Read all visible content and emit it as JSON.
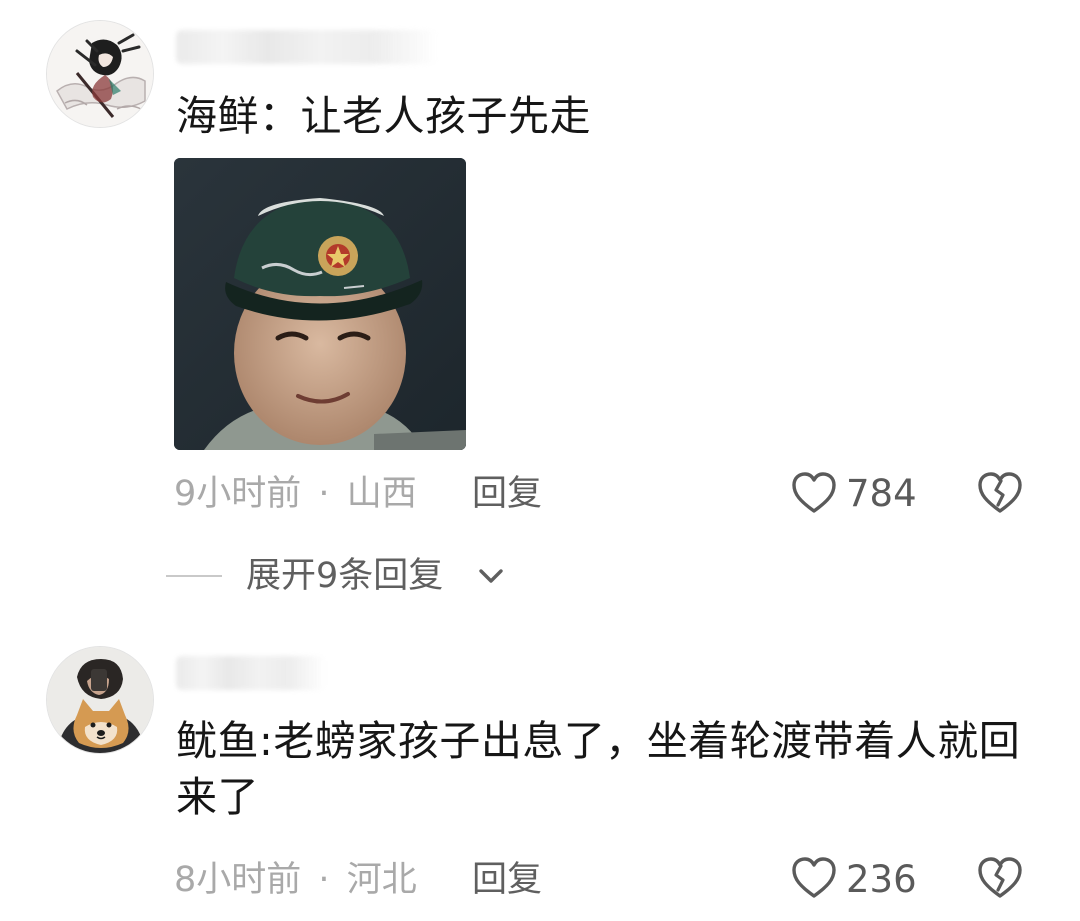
{
  "comments": [
    {
      "text": "海鲜：让老人孩子先走",
      "time": "9小时前",
      "separator": "·",
      "location": "山西",
      "reply_label": "回复",
      "likes": "784"
    },
    {
      "text": "鱿鱼:老螃家孩子出息了，坐着轮渡带着人就回来了",
      "time": "8小时前",
      "separator": "·",
      "location": "河北",
      "reply_label": "回复",
      "likes": "236"
    }
  ],
  "expand_replies": {
    "label": "展开9条回复"
  },
  "icons": {
    "like": "heart-outline-icon",
    "dislike": "broken-heart-icon",
    "expand": "chevron-down-icon"
  },
  "colors": {
    "meta": "#a9a9a9",
    "text": "#161616",
    "icon": "#5a5a5a"
  }
}
